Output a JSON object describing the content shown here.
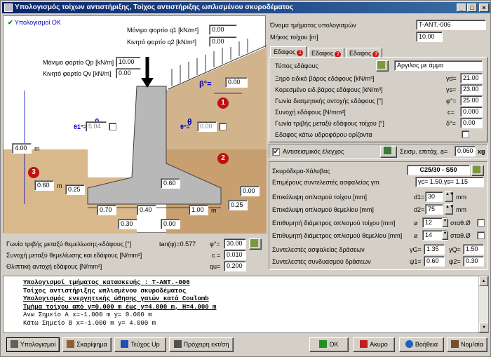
{
  "window": {
    "title": "Υπολογισμός τοίχων αντιστήριξης, Τοίχος αντιστήριξης ωπλισμένου σκυροδέματος"
  },
  "status": {
    "text": "Υπολογισμοί OK"
  },
  "drawing": {
    "q1_label": "Μόνιμο φορτίο q1 [kN/m²]",
    "q1_value": "0.00",
    "q2_label": "Κινητό φορτίο q2 [kN/m²]",
    "q2_value": "0.00",
    "qp_label": "Μόνιμο φορτίο Qp [kN/m]",
    "qp_value": "10.00",
    "qv_label": "Κινητό φορτίο Qv [kN/m]",
    "qv_value": "0.00",
    "beta_label": "β°=",
    "beta_value": "0.00",
    "theta1_label": "θ1°=",
    "theta1_value": "5.04",
    "theta_label": "θ°=",
    "theta_value": "0.00",
    "height_value": "4.00",
    "height_unit": "m",
    "h_left_value": "0.60",
    "h_left_unit": "m",
    "h_toe_value": "0.25",
    "h_base_value": "0.60",
    "h_right_value": "0.00",
    "h_heel_value": "0.25",
    "w_toe_value": "0.70",
    "w_stem_value": "0.40",
    "w_heel_value": "1.00",
    "w_heel_unit": "m",
    "w_left_top": "0.30",
    "w_right_top": "0.00",
    "badge1": "1",
    "badge2": "2",
    "badge3": "3"
  },
  "foundation": {
    "friction_label": "Γωνία τριβής μεταξύ θεμελίωσης-εδάφους [°]",
    "tan_text": "tan(φ)=0.577",
    "phi_label": "φ°=",
    "phi_value": "30.00",
    "cohesion_label": "Συνοχή μεταξύ θεμελίωσης και εδάφους [N/mm²]",
    "c_label": "c =",
    "c_value": "0.010",
    "bearing_label": "Θλιπτική αντοχή εδάφους [N/mm²]",
    "qu_label": "qu=",
    "qu_value": "0.200"
  },
  "section": {
    "name_label": "Όνομα τμήματος υπολογισμών",
    "name_value": "T-ANT.-006",
    "length_label": "Μήκος τοίχου [m]",
    "length_value": "10.00"
  },
  "soil_tabs": [
    {
      "label": "Εδαφος",
      "badge": "1"
    },
    {
      "label": "Εδαφος",
      "badge": "2"
    },
    {
      "label": "Εδαφος",
      "badge": "3"
    }
  ],
  "soil": {
    "type_label": "Τύπος εδάφους",
    "type_value": "Αργιλος με άμμο",
    "rows": [
      {
        "label": "Ξηρό ειδικό βάρος εδάφους [kN/m³]",
        "sym": "γd=",
        "value": "21.00"
      },
      {
        "label": "Κορεσμένο ειδ.βάρος εδάφους [kN/m³]",
        "sym": "γs=",
        "value": "23.00"
      },
      {
        "label": "Γωνία διατμητικής αντοχής εδάφους [°]",
        "sym": "φ°=",
        "value": "25.00"
      },
      {
        "label": "Συνοχή εδάφους  [N/mm²]",
        "sym": "c=",
        "value": "0.000"
      },
      {
        "label": "Γωνία τριβής μεταξύ εδάφους τοίχου [°]",
        "sym": "δ°=",
        "value": "0.00"
      }
    ],
    "water_label": "Εδαφος κάτω υδροφόρου ορίζοντα"
  },
  "seismic": {
    "check_label": "Αντισεισμικός έλεγχος",
    "accel_label": "Σεισμ. επιτάχ.  a=",
    "accel_value": "0.060",
    "accel_unit": "xg"
  },
  "concrete": {
    "label": "Σκυρόδεμα-Χάλυβας",
    "grade": "C25/30 - S50",
    "safety_label": "Επιμέρους συντελεστές ασφαλείας γm",
    "safety_value": "γc= 1.50,γs= 1.15",
    "cover_wall_label": "Επικάλυψη οπλισμού τοίχου [mm]",
    "d1_label": "d1=",
    "d1_value": "30",
    "mm1": "mm",
    "cover_found_label": "Επικάλυψη οπλισμού θεμελίου [mm]",
    "d2_label": "d2=",
    "d2_value": "75",
    "mm2": "mm",
    "dia_wall_label": "Επιθυμητή διάμετρος οπλισμού τοίχου [mm]",
    "dia_wall_value": "12",
    "stab1": "σταθ.Ø",
    "dia_found_label": "Επιθυμητή διάμετρος οπλισμού θεμελίου [mm]",
    "dia_found_value": "14",
    "stab2": "σταθ.Ø",
    "safety_act_label": "Συντελεστές ασφαλείας δράσεων",
    "gG_label": "γG=",
    "gG_value": "1.35",
    "gQ_label": "γQ=",
    "gQ_value": "1.50",
    "comb_label": "Συντελεστές συνδυασμού δράσεων",
    "psi1_label": "ψ1=",
    "psi1_value": "0.60",
    "psi2_label": "ψ2=",
    "psi2_value": "0.30"
  },
  "log": [
    "Υπολογισμοί τμήματος κατασκευής : T-ANT.-006",
    "Τοίχος αντιστήριξης ωπλισμένου σκυροδέματος",
    "Υπολογισμός ενεργητικής ώθησης γαιών κατά Coulomb",
    "Τμήμα τοίχου από y=0.000 m έως y=4.000 m, H=4.000 m",
    "Ανω  Σημείο Α x=-1.000 m y= 0.000 m",
    "Κάτω Σημείο Β x=-1.000 m y= 4.000 m"
  ],
  "buttons": {
    "calc": "Υπολογισμοί",
    "sketch": "Σκαρίφημα",
    "report": "Τεύχος Up",
    "draft": "Πρόχειρη εκτ/ση",
    "ok": "OK",
    "cancel": "Ακυρο",
    "help": "Βοήθεια",
    "units": "Νομ/σία"
  }
}
